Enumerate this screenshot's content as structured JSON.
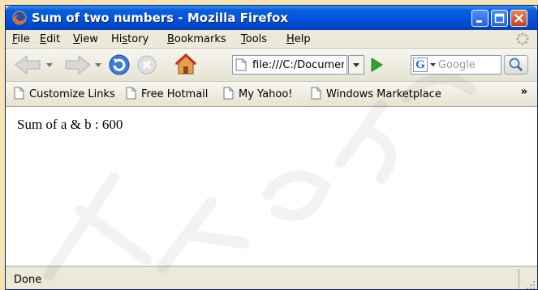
{
  "window": {
    "title": "Sum of two numbers - Mozilla Firefox",
    "accent": "#0454e1"
  },
  "menu": {
    "items": [
      {
        "label": "File",
        "ul": "F",
        "rest": "ile"
      },
      {
        "label": "Edit",
        "ul": "E",
        "rest": "dit"
      },
      {
        "label": "View",
        "ul": "V",
        "rest": "iew"
      },
      {
        "label": "History",
        "pre": "Hi",
        "ul": "s",
        "rest": "tory"
      },
      {
        "label": "Bookmarks",
        "ul": "B",
        "rest": "ookmarks"
      },
      {
        "label": "Tools",
        "ul": "T",
        "rest": "ools"
      },
      {
        "label": "Help",
        "ul": "H",
        "rest": "elp"
      }
    ]
  },
  "navigation": {
    "url": "file:///C:/Documents",
    "search_placeholder": "Google",
    "icons": [
      "back-arrow-icon",
      "forward-arrow-icon",
      "reload-icon",
      "stop-icon",
      "home-icon",
      "go-icon",
      "search-icon"
    ]
  },
  "bookmarks": {
    "items": [
      "Customize Links",
      "Free Hotmail",
      "My Yahoo!",
      "Windows Marketplace"
    ],
    "overflow": "»"
  },
  "content": {
    "text": "Sum of a & b : 600"
  },
  "status": {
    "text": "Done"
  }
}
